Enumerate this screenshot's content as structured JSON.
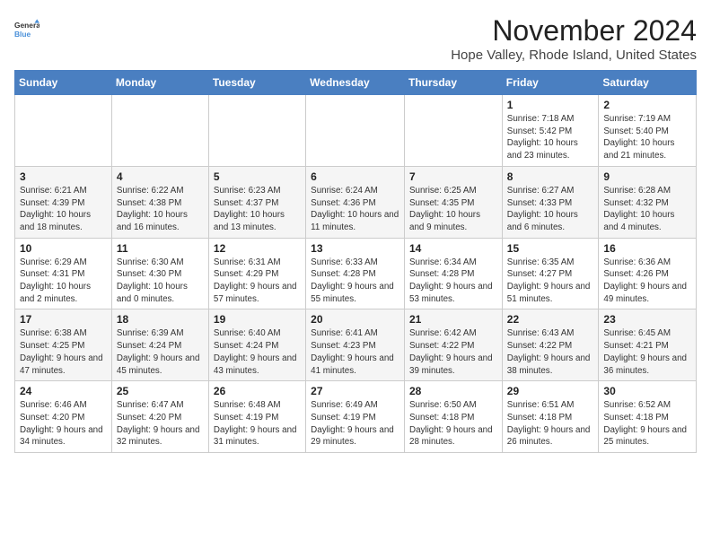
{
  "logo": {
    "general": "General",
    "blue": "Blue"
  },
  "title": "November 2024",
  "location": "Hope Valley, Rhode Island, United States",
  "weekdays": [
    "Sunday",
    "Monday",
    "Tuesday",
    "Wednesday",
    "Thursday",
    "Friday",
    "Saturday"
  ],
  "weeks": [
    [
      {
        "day": "",
        "info": ""
      },
      {
        "day": "",
        "info": ""
      },
      {
        "day": "",
        "info": ""
      },
      {
        "day": "",
        "info": ""
      },
      {
        "day": "",
        "info": ""
      },
      {
        "day": "1",
        "info": "Sunrise: 7:18 AM\nSunset: 5:42 PM\nDaylight: 10 hours and 23 minutes."
      },
      {
        "day": "2",
        "info": "Sunrise: 7:19 AM\nSunset: 5:40 PM\nDaylight: 10 hours and 21 minutes."
      }
    ],
    [
      {
        "day": "3",
        "info": "Sunrise: 6:21 AM\nSunset: 4:39 PM\nDaylight: 10 hours and 18 minutes."
      },
      {
        "day": "4",
        "info": "Sunrise: 6:22 AM\nSunset: 4:38 PM\nDaylight: 10 hours and 16 minutes."
      },
      {
        "day": "5",
        "info": "Sunrise: 6:23 AM\nSunset: 4:37 PM\nDaylight: 10 hours and 13 minutes."
      },
      {
        "day": "6",
        "info": "Sunrise: 6:24 AM\nSunset: 4:36 PM\nDaylight: 10 hours and 11 minutes."
      },
      {
        "day": "7",
        "info": "Sunrise: 6:25 AM\nSunset: 4:35 PM\nDaylight: 10 hours and 9 minutes."
      },
      {
        "day": "8",
        "info": "Sunrise: 6:27 AM\nSunset: 4:33 PM\nDaylight: 10 hours and 6 minutes."
      },
      {
        "day": "9",
        "info": "Sunrise: 6:28 AM\nSunset: 4:32 PM\nDaylight: 10 hours and 4 minutes."
      }
    ],
    [
      {
        "day": "10",
        "info": "Sunrise: 6:29 AM\nSunset: 4:31 PM\nDaylight: 10 hours and 2 minutes."
      },
      {
        "day": "11",
        "info": "Sunrise: 6:30 AM\nSunset: 4:30 PM\nDaylight: 10 hours and 0 minutes."
      },
      {
        "day": "12",
        "info": "Sunrise: 6:31 AM\nSunset: 4:29 PM\nDaylight: 9 hours and 57 minutes."
      },
      {
        "day": "13",
        "info": "Sunrise: 6:33 AM\nSunset: 4:28 PM\nDaylight: 9 hours and 55 minutes."
      },
      {
        "day": "14",
        "info": "Sunrise: 6:34 AM\nSunset: 4:28 PM\nDaylight: 9 hours and 53 minutes."
      },
      {
        "day": "15",
        "info": "Sunrise: 6:35 AM\nSunset: 4:27 PM\nDaylight: 9 hours and 51 minutes."
      },
      {
        "day": "16",
        "info": "Sunrise: 6:36 AM\nSunset: 4:26 PM\nDaylight: 9 hours and 49 minutes."
      }
    ],
    [
      {
        "day": "17",
        "info": "Sunrise: 6:38 AM\nSunset: 4:25 PM\nDaylight: 9 hours and 47 minutes."
      },
      {
        "day": "18",
        "info": "Sunrise: 6:39 AM\nSunset: 4:24 PM\nDaylight: 9 hours and 45 minutes."
      },
      {
        "day": "19",
        "info": "Sunrise: 6:40 AM\nSunset: 4:24 PM\nDaylight: 9 hours and 43 minutes."
      },
      {
        "day": "20",
        "info": "Sunrise: 6:41 AM\nSunset: 4:23 PM\nDaylight: 9 hours and 41 minutes."
      },
      {
        "day": "21",
        "info": "Sunrise: 6:42 AM\nSunset: 4:22 PM\nDaylight: 9 hours and 39 minutes."
      },
      {
        "day": "22",
        "info": "Sunrise: 6:43 AM\nSunset: 4:22 PM\nDaylight: 9 hours and 38 minutes."
      },
      {
        "day": "23",
        "info": "Sunrise: 6:45 AM\nSunset: 4:21 PM\nDaylight: 9 hours and 36 minutes."
      }
    ],
    [
      {
        "day": "24",
        "info": "Sunrise: 6:46 AM\nSunset: 4:20 PM\nDaylight: 9 hours and 34 minutes."
      },
      {
        "day": "25",
        "info": "Sunrise: 6:47 AM\nSunset: 4:20 PM\nDaylight: 9 hours and 32 minutes."
      },
      {
        "day": "26",
        "info": "Sunrise: 6:48 AM\nSunset: 4:19 PM\nDaylight: 9 hours and 31 minutes."
      },
      {
        "day": "27",
        "info": "Sunrise: 6:49 AM\nSunset: 4:19 PM\nDaylight: 9 hours and 29 minutes."
      },
      {
        "day": "28",
        "info": "Sunrise: 6:50 AM\nSunset: 4:18 PM\nDaylight: 9 hours and 28 minutes."
      },
      {
        "day": "29",
        "info": "Sunrise: 6:51 AM\nSunset: 4:18 PM\nDaylight: 9 hours and 26 minutes."
      },
      {
        "day": "30",
        "info": "Sunrise: 6:52 AM\nSunset: 4:18 PM\nDaylight: 9 hours and 25 minutes."
      }
    ]
  ]
}
